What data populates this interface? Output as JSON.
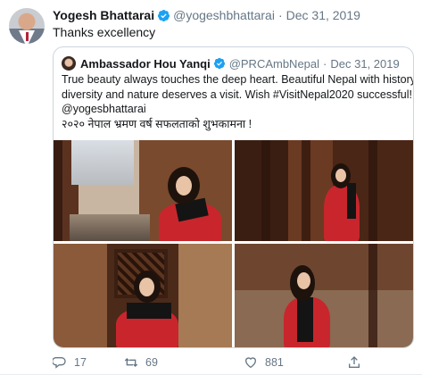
{
  "tweet": {
    "author": {
      "display_name": "Yogesh Bhattarai",
      "handle": "@yogeshbhattarai",
      "verified": true
    },
    "separator": "·",
    "date": "Dec 31, 2019",
    "text": "Thanks excellency",
    "quoted": {
      "author": {
        "display_name": "Ambassador Hou Yanqi",
        "handle": "@PRCAmbNepal",
        "verified": true
      },
      "separator": "·",
      "date": "Dec 31, 2019",
      "text_lines": [
        "True beauty always touches the deep heart.  Beautiful Nepal with history,",
        "diversity and nature deserves a visit.  Wish #VisitNepal2020 successful!",
        "@yogesbhattarai",
        "२०२० नेपाल भ्रमण वर्ष सफलताको शुभकामना !"
      ],
      "photo_count": 4
    },
    "actions": {
      "reply_count": "17",
      "retweet_count": "69",
      "like_count": "881"
    }
  },
  "colors": {
    "verified_blue": "#1da1f2",
    "secondary_text": "#657786",
    "border": "#ccd6dd"
  }
}
